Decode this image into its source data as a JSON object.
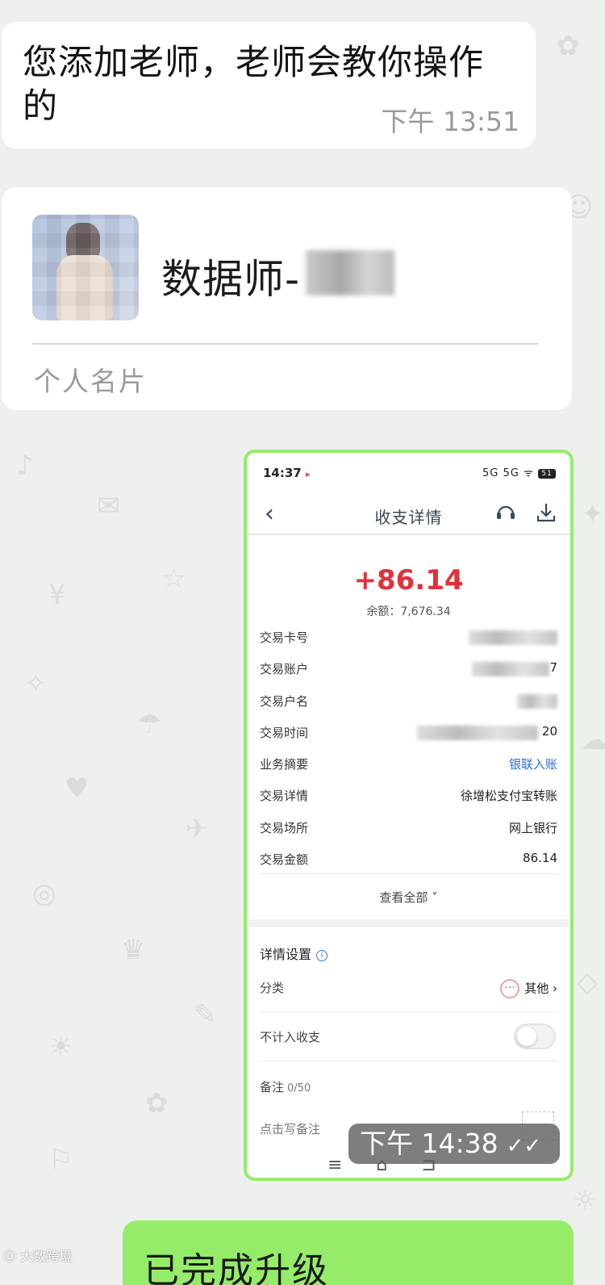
{
  "chat": {
    "incoming_text": {
      "text": "您添加老师，老师会教你操作的",
      "time": "下午  13:51"
    },
    "contact_card": {
      "name": "数据师-",
      "label": "个人名片"
    },
    "image_message": {
      "time": "下午  14:38",
      "ticks": "✓✓",
      "screenshot": {
        "status_time": "14:37",
        "status_icons": "5G 5G ᯤ",
        "battery": "51",
        "nav_title": "收支详情",
        "amount": "+86.14",
        "balance": "余额：7,676.34",
        "rows": [
          {
            "key": "交易卡号",
            "value": "",
            "blurred": true
          },
          {
            "key": "交易账户",
            "value": "7",
            "blurred": true
          },
          {
            "key": "交易户名",
            "value": "",
            "blurred": true
          },
          {
            "key": "交易时间",
            "value": "20",
            "blurred": true
          },
          {
            "key": "业务摘要",
            "value": "银联入账",
            "blurred": false
          },
          {
            "key": "交易详情",
            "value": "徐增松支付宝转账",
            "blurred": false
          },
          {
            "key": "交易场所",
            "value": "网上银行",
            "blurred": false
          },
          {
            "key": "交易金额",
            "value": "86.14",
            "blurred": false
          }
        ],
        "view_all": "查看全部 ˅",
        "details_title": "详情设置",
        "category_label": "分类",
        "category_value": "其他",
        "exclude_label": "不计入收支",
        "note_label": "备注",
        "note_count": "0/50",
        "note_placeholder": "点击写备注"
      }
    },
    "outgoing_text": {
      "text": "已完成升级"
    },
    "watermark": "大数跨境"
  },
  "colors": {
    "background": "#eef0ee",
    "outgoing_bubble": "#95ec69",
    "amount_red": "#e0323b",
    "link_blue": "#2b6fd6"
  }
}
